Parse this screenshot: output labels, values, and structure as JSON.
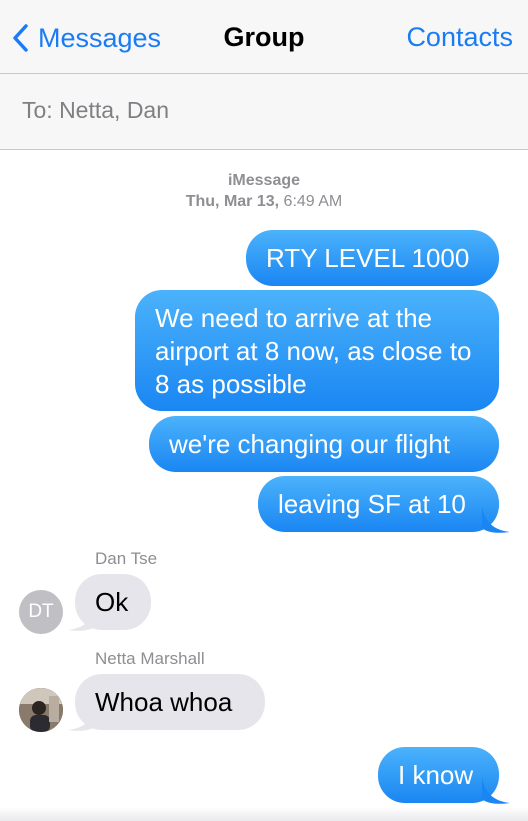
{
  "nav": {
    "back_label": "Messages",
    "title": "Group",
    "contacts_label": "Contacts",
    "accent": "#1a7cf5"
  },
  "to_field": {
    "text": "To: Netta, Dan"
  },
  "thread_header": {
    "service": "iMessage",
    "date": "Thu, Mar 13,",
    "time": "6:49 AM"
  },
  "messages": [
    {
      "direction": "outgoing",
      "text": "RTY LEVEL 1000"
    },
    {
      "direction": "outgoing",
      "text": "We need to arrive at the airport at 8 now, as close to 8 as possible"
    },
    {
      "direction": "outgoing",
      "text": "we're changing our flight"
    },
    {
      "direction": "outgoing",
      "text": "leaving SF at 10"
    },
    {
      "direction": "incoming",
      "sender": "Dan Tse",
      "avatar_initials": "DT",
      "text": "Ok"
    },
    {
      "direction": "incoming",
      "sender": "Netta Marshall",
      "avatar_icon": "photo-avatar",
      "text": "Whoa whoa"
    },
    {
      "direction": "outgoing",
      "text": "I know"
    }
  ],
  "colors": {
    "outgoing_bubble": "#1a8cf5",
    "incoming_bubble": "#e6e5eb"
  }
}
